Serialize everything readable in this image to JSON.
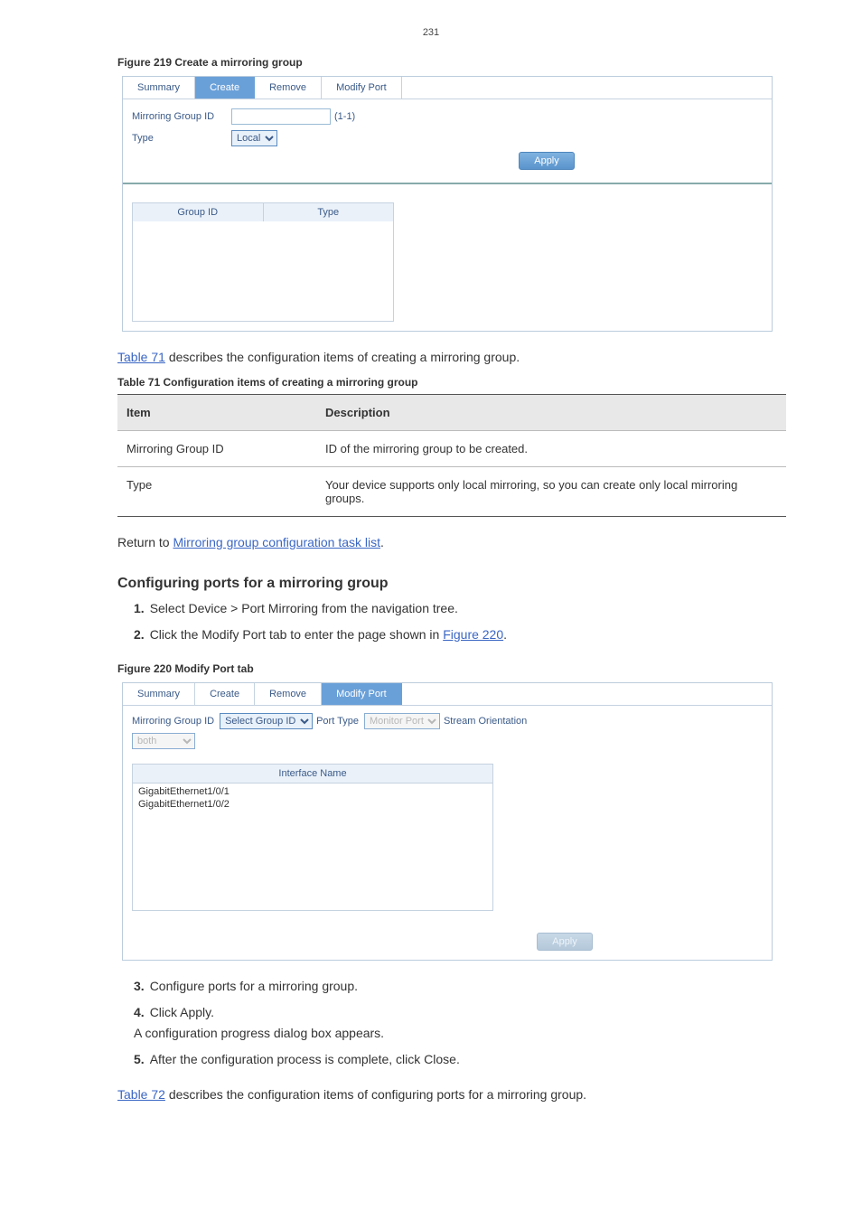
{
  "page_number": "231",
  "figure2": {
    "caption": "Figure 219 Create a mirroring group",
    "tabs": {
      "summary": "Summary",
      "create": "Create",
      "remove": "Remove",
      "modify": "Modify Port"
    },
    "labels": {
      "group_id": "Mirroring Group ID",
      "type": "Type"
    },
    "group_id_value": "",
    "group_id_hint": "(1-1)",
    "type_value": "Local",
    "apply": "Apply",
    "grid": {
      "col1": "Group ID",
      "col2": "Type"
    }
  },
  "text_after_fig2": {
    "pre": "",
    "link": "Table 71",
    "post": " describes the configuration items of creating a mirroring group."
  },
  "table71": {
    "title": "Table 71 Configuration items of creating a mirroring group",
    "h1": "Item",
    "h2": "Description",
    "rows": [
      {
        "item": "Mirroring Group ID",
        "desc": "ID of the mirroring group to be created."
      },
      {
        "item": "Type",
        "desc": "Your device supports only local mirroring, so you can create only local mirroring groups."
      }
    ]
  },
  "return_link": {
    "pre": "Return to ",
    "link": "Mirroring group configuration task list",
    "post": "."
  },
  "section_title": "Configuring ports for a mirroring group",
  "steps": {
    "s1_num": "1.",
    "s1_text": "Select Device > Port Mirroring from the navigation tree.",
    "s2_num": "2.",
    "s2_text_pre": "Click the Modify Port tab to enter the page shown in ",
    "s2_link": "Figure 220",
    "s2_text_post": ".",
    "s3_num": "3.",
    "s3_text": "Configure ports for a mirroring group.",
    "s4_num": "4.",
    "s4_text": "Click Apply.",
    "s4_sub": "A configuration progress dialog box appears.",
    "s5_num": "5.",
    "s5_text": "After the configuration process is complete, click Close."
  },
  "figure3": {
    "caption": "Figure 220 Modify Port tab",
    "tabs": {
      "summary": "Summary",
      "create": "Create",
      "remove": "Remove",
      "modify": "Modify Port"
    },
    "labels": {
      "group_id": "Mirroring Group ID",
      "port_type": "Port Type",
      "stream": "Stream Orientation"
    },
    "group_id_value": "Select Group ID",
    "port_type_value": "Monitor Port",
    "stream_value": "both",
    "iface_header": "Interface Name",
    "iface_rows": [
      "GigabitEthernet1/0/1",
      "GigabitEthernet1/0/2"
    ],
    "apply": "Apply"
  },
  "text_after_fig3": {
    "pre": "",
    "link": "Table 72",
    "post": " describes the configuration items of configuring ports for a mirroring group."
  }
}
